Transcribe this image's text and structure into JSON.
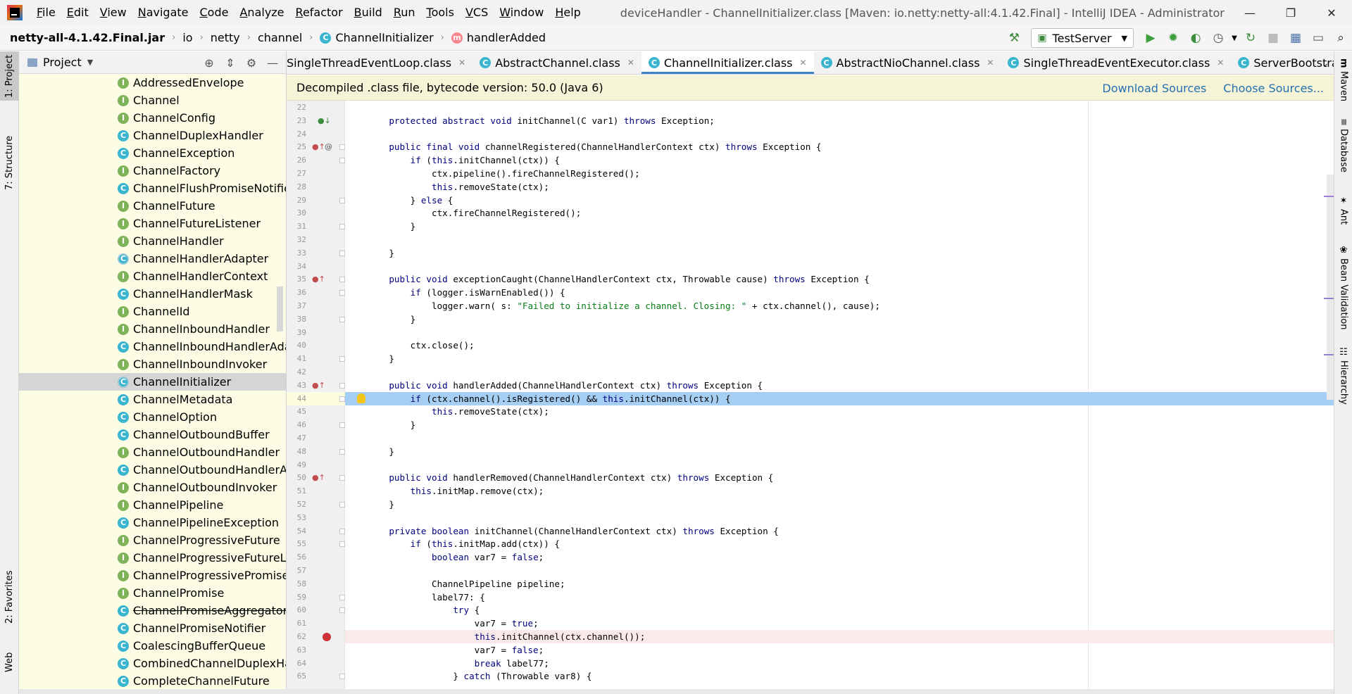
{
  "titlebar": {
    "menus": [
      "File",
      "Edit",
      "View",
      "Navigate",
      "Code",
      "Analyze",
      "Refactor",
      "Build",
      "Run",
      "Tools",
      "VCS",
      "Window",
      "Help"
    ],
    "window_title": "deviceHandler - ChannelInitializer.class [Maven: io.netty:netty-all:4.1.42.Final] - IntelliJ IDEA - Administrator"
  },
  "navbar": {
    "crumbs": [
      "netty-all-4.1.42.Final.jar",
      "io",
      "netty",
      "channel",
      "ChannelInitializer",
      "handlerAdded"
    ],
    "run_config": "TestServer"
  },
  "left_strip": {
    "project_tab": "1: Project",
    "structure_tab": "7: Structure",
    "favorites_tab": "2: Favorites",
    "web_tab": "Web"
  },
  "right_strip": {
    "maven": "Maven",
    "database": "Database",
    "ant": "Ant",
    "bean_validation": "Bean Validation",
    "hierarchy": "Hierarchy"
  },
  "project": {
    "title": "Project",
    "items": [
      {
        "kind": "I",
        "label": "AddressedEnvelope"
      },
      {
        "kind": "I",
        "label": "Channel"
      },
      {
        "kind": "I",
        "label": "ChannelConfig"
      },
      {
        "kind": "C",
        "label": "ChannelDuplexHandler"
      },
      {
        "kind": "C",
        "label": "ChannelException"
      },
      {
        "kind": "I",
        "label": "ChannelFactory"
      },
      {
        "kind": "C",
        "label": "ChannelFlushPromiseNotifier"
      },
      {
        "kind": "I",
        "label": "ChannelFuture"
      },
      {
        "kind": "I",
        "label": "ChannelFutureListener"
      },
      {
        "kind": "I",
        "label": "ChannelHandler"
      },
      {
        "kind": "CA",
        "label": "ChannelHandlerAdapter"
      },
      {
        "kind": "I",
        "label": "ChannelHandlerContext"
      },
      {
        "kind": "C",
        "label": "ChannelHandlerMask"
      },
      {
        "kind": "I",
        "label": "ChannelId"
      },
      {
        "kind": "I",
        "label": "ChannelInboundHandler"
      },
      {
        "kind": "C",
        "label": "ChannelInboundHandlerAdapter"
      },
      {
        "kind": "I",
        "label": "ChannelInboundInvoker"
      },
      {
        "kind": "CA",
        "label": "ChannelInitializer",
        "selected": true
      },
      {
        "kind": "C",
        "label": "ChannelMetadata"
      },
      {
        "kind": "C",
        "label": "ChannelOption"
      },
      {
        "kind": "C",
        "label": "ChannelOutboundBuffer"
      },
      {
        "kind": "I",
        "label": "ChannelOutboundHandler"
      },
      {
        "kind": "C",
        "label": "ChannelOutboundHandlerAdapter"
      },
      {
        "kind": "I",
        "label": "ChannelOutboundInvoker"
      },
      {
        "kind": "I",
        "label": "ChannelPipeline"
      },
      {
        "kind": "C",
        "label": "ChannelPipelineException"
      },
      {
        "kind": "I",
        "label": "ChannelProgressiveFuture"
      },
      {
        "kind": "I",
        "label": "ChannelProgressiveFutureListener"
      },
      {
        "kind": "I",
        "label": "ChannelProgressivePromise"
      },
      {
        "kind": "I",
        "label": "ChannelPromise"
      },
      {
        "kind": "C",
        "label": "ChannelPromiseAggregator",
        "struck": true
      },
      {
        "kind": "C",
        "label": "ChannelPromiseNotifier"
      },
      {
        "kind": "C",
        "label": "CoalescingBufferQueue"
      },
      {
        "kind": "C",
        "label": "CombinedChannelDuplexHandler"
      },
      {
        "kind": "C",
        "label": "CompleteChannelFuture"
      }
    ]
  },
  "tabs": [
    {
      "label": "SingleThreadEventLoop.class",
      "icon": false
    },
    {
      "label": "AbstractChannel.class",
      "icon": true
    },
    {
      "label": "ChannelInitializer.class",
      "icon": true,
      "active": true
    },
    {
      "label": "AbstractNioChannel.class",
      "icon": true
    },
    {
      "label": "SingleThreadEventExecutor.class",
      "icon": true
    },
    {
      "label": "ServerBootstrap.class",
      "icon": true
    }
  ],
  "banner": {
    "text": "Decompiled .class file, bytecode version: 50.0 (Java 6)",
    "download": "Download Sources",
    "choose": "Choose Sources..."
  },
  "code": {
    "lines": [
      {
        "n": "22",
        "t": ""
      },
      {
        "n": "23",
        "t": "    <kw>protected abstract void</kw> initChannel(C var1) <kw>throws</kw> Exception;"
      },
      {
        "n": "24",
        "t": ""
      },
      {
        "n": "25",
        "t": "    <kw>public final void</kw> channelRegistered(ChannelHandlerContext ctx) <kw>throws</kw> Exception {"
      },
      {
        "n": "26",
        "t": "        <kw>if</kw> (<kw>this</kw>.initChannel(ctx)) {"
      },
      {
        "n": "27",
        "t": "            ctx.pipeline().fireChannelRegistered();"
      },
      {
        "n": "28",
        "t": "            <kw>this</kw>.removeState(ctx);"
      },
      {
        "n": "29",
        "t": "        } <kw>else</kw> {"
      },
      {
        "n": "30",
        "t": "            ctx.fireChannelRegistered();"
      },
      {
        "n": "31",
        "t": "        }"
      },
      {
        "n": "32",
        "t": ""
      },
      {
        "n": "33",
        "t": "    }"
      },
      {
        "n": "34",
        "t": ""
      },
      {
        "n": "35",
        "t": "    <kw>public void</kw> exceptionCaught(ChannelHandlerContext ctx, Throwable cause) <kw>throws</kw> Exception {"
      },
      {
        "n": "36",
        "t": "        <kw>if</kw> (logger.isWarnEnabled()) {"
      },
      {
        "n": "37",
        "t": "            logger.warn( s: <str>\"Failed to initialize a channel. Closing: \"</str> + ctx.channel(), cause);"
      },
      {
        "n": "38",
        "t": "        }"
      },
      {
        "n": "39",
        "t": ""
      },
      {
        "n": "40",
        "t": "        ctx.close();"
      },
      {
        "n": "41",
        "t": "    }"
      },
      {
        "n": "42",
        "t": ""
      },
      {
        "n": "43",
        "t": "    <kw>public void</kw> handlerAdded(ChannelHandlerContext ctx) <kw>throws</kw> Exception {"
      },
      {
        "n": "44",
        "t": "        <kw>if</kw> (ctx.channel().isRegistered() && <kw>this</kw>.initChannel(ctx)) {",
        "current": true
      },
      {
        "n": "45",
        "t": "            <kw>this</kw>.removeState(ctx);"
      },
      {
        "n": "46",
        "t": "        }"
      },
      {
        "n": "47",
        "t": ""
      },
      {
        "n": "48",
        "t": "    }"
      },
      {
        "n": "49",
        "t": ""
      },
      {
        "n": "50",
        "t": "    <kw>public void</kw> handlerRemoved(ChannelHandlerContext ctx) <kw>throws</kw> Exception {"
      },
      {
        "n": "51",
        "t": "        <kw>this</kw>.initMap.remove(ctx);"
      },
      {
        "n": "52",
        "t": "    }"
      },
      {
        "n": "53",
        "t": ""
      },
      {
        "n": "54",
        "t": "    <kw>private boolean</kw> initChannel(ChannelHandlerContext ctx) <kw>throws</kw> Exception {"
      },
      {
        "n": "55",
        "t": "        <kw>if</kw> (<kw>this</kw>.initMap.add(ctx)) {"
      },
      {
        "n": "56",
        "t": "            <kw>boolean</kw> var7 = <kw>false</kw>;"
      },
      {
        "n": "57",
        "t": ""
      },
      {
        "n": "58",
        "t": "            ChannelPipeline pipeline;"
      },
      {
        "n": "59",
        "t": "            label77: {"
      },
      {
        "n": "60",
        "t": "                <kw>try</kw> {"
      },
      {
        "n": "61",
        "t": "                    var7 = <kw>true</kw>;"
      },
      {
        "n": "62",
        "t": "                    <kw>this</kw>.initChannel(ctx.channel());",
        "breakpoint": true
      },
      {
        "n": "63",
        "t": "                    var7 = <kw>false</kw>;"
      },
      {
        "n": "64",
        "t": "                    <kw>break</kw> label77;"
      },
      {
        "n": "65",
        "t": "                } <kw>catch</kw> (Throwable var8) {"
      }
    ]
  }
}
